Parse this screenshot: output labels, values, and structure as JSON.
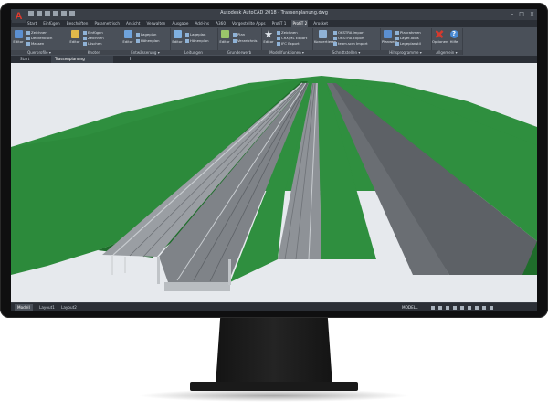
{
  "window": {
    "title": "Autodesk AutoCAD 2018 - Trassenplanung.dwg",
    "app_button": "A",
    "controls": [
      "–",
      "□",
      "×"
    ]
  },
  "ribbon": {
    "tabs": [
      "Start",
      "Einfügen",
      "Beschriften",
      "Parametrisch",
      "Ansicht",
      "Verwalten",
      "Ausgabe",
      "Add-ins",
      "A360",
      "Vorgestellte Apps",
      "ProfiT 1",
      "ProfiT 2",
      "Arosket"
    ],
    "active_tab_index": 11,
    "panels": {
      "querprofile": {
        "title": "Querprofile ▾",
        "big": "Editor",
        "small": [
          "Zeichnen",
          "Deckenbuch",
          "Massen"
        ]
      },
      "knoten": {
        "title": "Knoten",
        "big": "Editor",
        "small": [
          "Einfügen",
          "Zeichnen",
          "Löschen"
        ]
      },
      "entwaesserung": {
        "title": "Entwässerung ▾",
        "big": "Editor",
        "small": [
          "Lageplan",
          "Höhenplan"
        ]
      },
      "leitungen": {
        "title": "Leitungen",
        "big": "Editor",
        "small": [
          "Lageplan",
          "Höhenplan"
        ]
      },
      "grunderwerb": {
        "title": "Grunderwerb",
        "big": "Editor",
        "small": [
          "Plan",
          "Verzeichnis"
        ]
      },
      "modellfunktionen": {
        "title": "Modellfunktionen ▾",
        "big": "Editor",
        "small": [
          "Zeichnen",
          "CRX/ML Export",
          "IFC Export"
        ]
      },
      "schnittstellen": {
        "title": "Schnittstellen ▾",
        "big": "Konvertieren",
        "small": [
          "OKSTRA Import",
          "OKSTRA Export",
          "team.scm Import"
        ]
      },
      "hilfsprogramme": {
        "title": "Hilfsprogramme ▾",
        "big": "Planwerk",
        "small": [
          "Planrahmen",
          "Layer-Tools",
          "Legeplanstil"
        ]
      },
      "allgemein": {
        "title": "Allgemein ▾",
        "buttons": [
          "Optionen",
          "Hilfe"
        ]
      }
    }
  },
  "document_tabs": [
    "Start",
    "Trassenplanung"
  ],
  "active_document_tab": 1,
  "layout_tabs": [
    "Modell",
    "Layout1",
    "Layout2"
  ],
  "status": {
    "space": "MODELL"
  },
  "colors": {
    "background": "#e6e9ed",
    "terrain": "#2f8f3f",
    "terrain_dark": "#1f6d2b",
    "road": "#9a9ea3",
    "asphalt": "#5d6166",
    "accent": "#e23b2e"
  },
  "icons": [
    "autocad-logo-icon",
    "save-icon",
    "undo-icon",
    "redo-icon",
    "print-icon",
    "options-icon",
    "help-icon"
  ]
}
